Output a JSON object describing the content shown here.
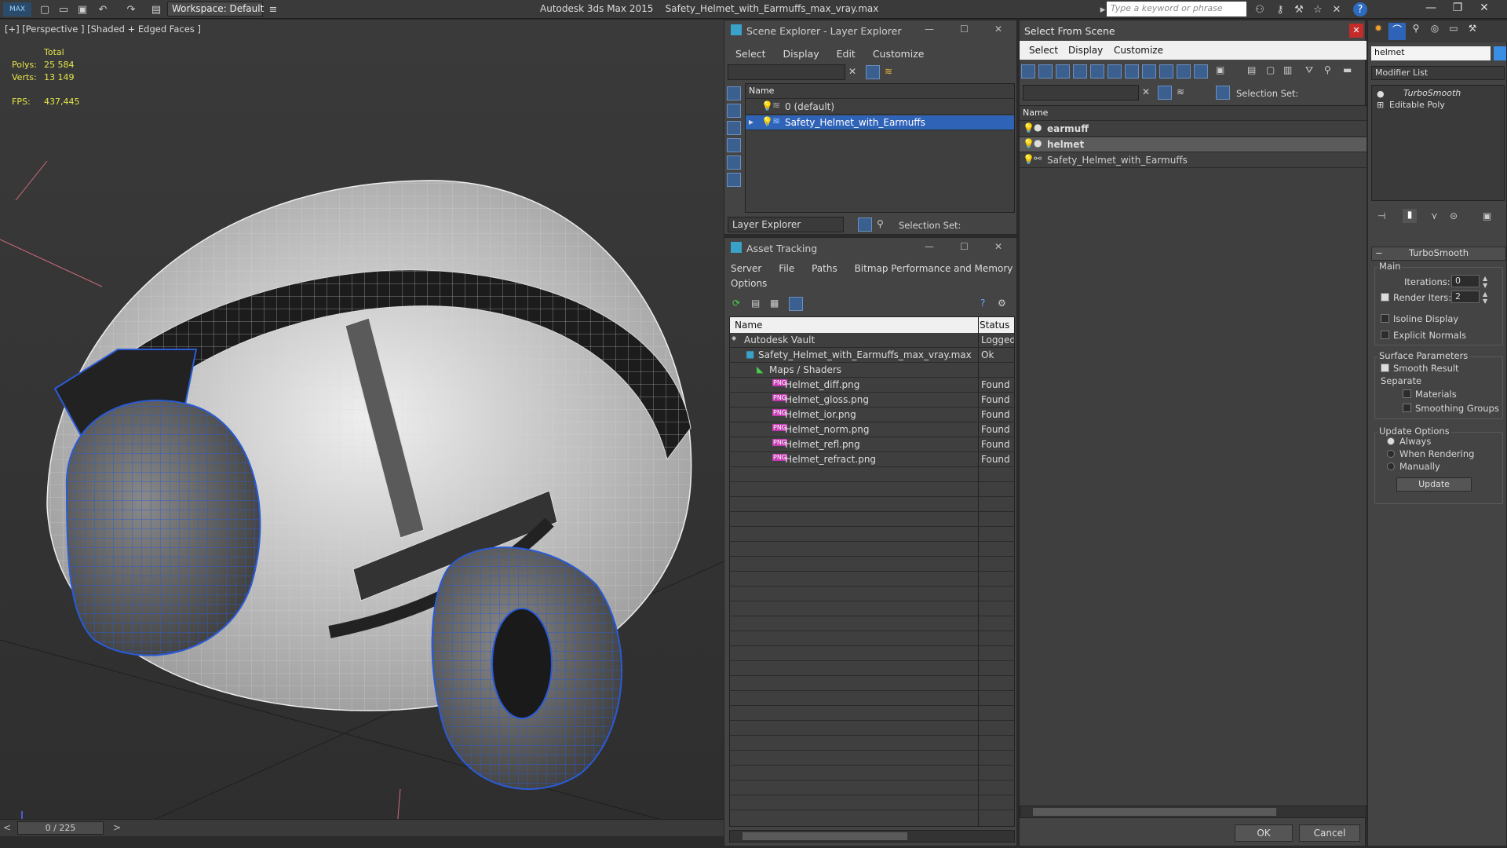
{
  "app": {
    "title": "Autodesk 3ds Max  2015",
    "file": "Safety_Helmet_with_Earmuffs_max_vray.max",
    "workspace": "Workspace: Default",
    "search_placeholder": "Type a keyword or phrase",
    "logo": "MAX"
  },
  "viewport": {
    "label": "[+] [Perspective ] [Shaded + Edged Faces ]",
    "stats": {
      "total_label": "Total",
      "polys_label": "Polys:",
      "polys": "25 584",
      "verts_label": "Verts:",
      "verts": "13 149",
      "fps_label": "FPS:",
      "fps": "437,445"
    },
    "timeline": "0 / 225"
  },
  "scene_explorer": {
    "title": "Scene Explorer - Layer Explorer",
    "menu": [
      "Select",
      "Display",
      "Edit",
      "Customize"
    ],
    "col_name": "Name",
    "rows": [
      "0 (default)",
      "Safety_Helmet_with_Earmuffs"
    ],
    "footer_dropdown": "Layer Explorer",
    "selection_set": "Selection Set:"
  },
  "asset_tracking": {
    "title": "Asset Tracking",
    "menu": [
      "Server",
      "File",
      "Paths",
      "Bitmap Performance and Memory",
      "Options"
    ],
    "col_name": "Name",
    "col_status": "Status",
    "rows": [
      {
        "name": "Autodesk Vault",
        "status": "Logged"
      },
      {
        "name": "Safety_Helmet_with_Earmuffs_max_vray.max",
        "status": "Ok"
      },
      {
        "name": "Maps / Shaders",
        "status": ""
      },
      {
        "name": "Helmet_diff.png",
        "status": "Found"
      },
      {
        "name": "Helmet_gloss.png",
        "status": "Found"
      },
      {
        "name": "Helmet_ior.png",
        "status": "Found"
      },
      {
        "name": "Helmet_norm.png",
        "status": "Found"
      },
      {
        "name": "Helmet_refl.png",
        "status": "Found"
      },
      {
        "name": "Helmet_refract.png",
        "status": "Found"
      }
    ],
    "png_tag": "PNG"
  },
  "select_scene": {
    "title": "Select From Scene",
    "menu": [
      "Select",
      "Display",
      "Customize"
    ],
    "selection_set": "Selection Set:",
    "col_name": "Name",
    "rows": [
      "earmuff",
      "helmet",
      "Safety_Helmet_with_Earmuffs"
    ],
    "ok": "OK",
    "cancel": "Cancel"
  },
  "modify": {
    "object_name": "helmet",
    "modifier_list": "Modifier List",
    "stack": [
      "TurboSmooth",
      "Editable Poly"
    ],
    "rollout": "TurboSmooth",
    "main": "Main",
    "iterations_label": "Iterations:",
    "iterations": "0",
    "render_iters_label": "Render Iters:",
    "render_iters": "2",
    "isoline": "Isoline Display",
    "explicit": "Explicit Normals",
    "surface": "Surface Parameters",
    "smooth_result": "Smooth Result",
    "separate": "Separate",
    "materials": "Materials",
    "smoothing_groups": "Smoothing Groups",
    "update_options": "Update Options",
    "always": "Always",
    "when_rendering": "When Rendering",
    "manually": "Manually",
    "update_btn": "Update"
  },
  "colors": {
    "selection": "#2f63b8",
    "stats": "#e6e64a",
    "wire_blue": "#2a5bd6"
  }
}
